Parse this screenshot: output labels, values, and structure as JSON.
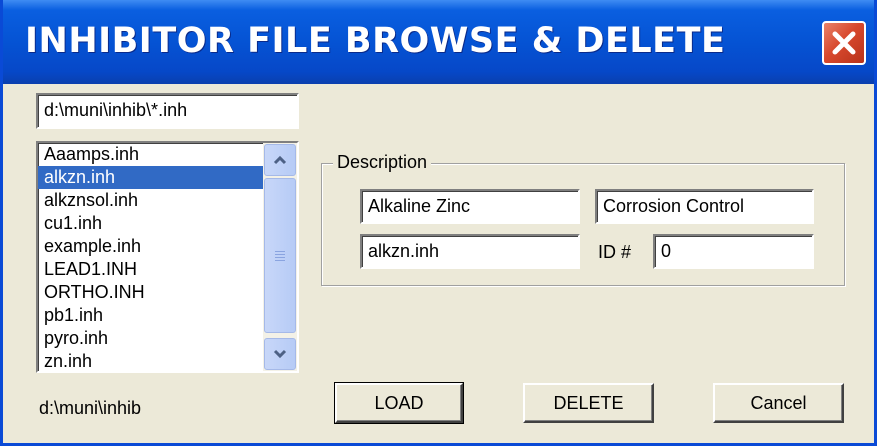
{
  "window": {
    "title": "INHIBITOR FILE BROWSE & DELETE",
    "close_icon": "close-x-icon"
  },
  "file_filter": {
    "value": "d:\\muni\\inhib\\*.inh"
  },
  "file_list": {
    "items": [
      "Aaamps.inh",
      "alkzn.inh",
      "alkznsol.inh",
      "cu1.inh",
      "example.inh",
      "LEAD1.INH",
      "ORTHO.INH",
      "pb1.inh",
      "pyro.inh",
      "zn.inh"
    ],
    "selected_index": 1,
    "scroll_up_icon": "chevron-up-icon",
    "scroll_down_icon": "chevron-down-icon"
  },
  "current_directory": "d:\\muni\\inhib",
  "description": {
    "group_label": "Description",
    "name_value": "Alkaline Zinc",
    "category_value": "Corrosion Control",
    "filename_value": "alkzn.inh",
    "id_label": "ID #",
    "id_value": "0"
  },
  "buttons": {
    "load": "LOAD",
    "delete": "DELETE",
    "cancel": "Cancel"
  },
  "colors": {
    "title_bar": "#0553d4",
    "selection": "#316ac5",
    "close_button": "#d8492e",
    "dialog_background": "#ece9d8"
  }
}
